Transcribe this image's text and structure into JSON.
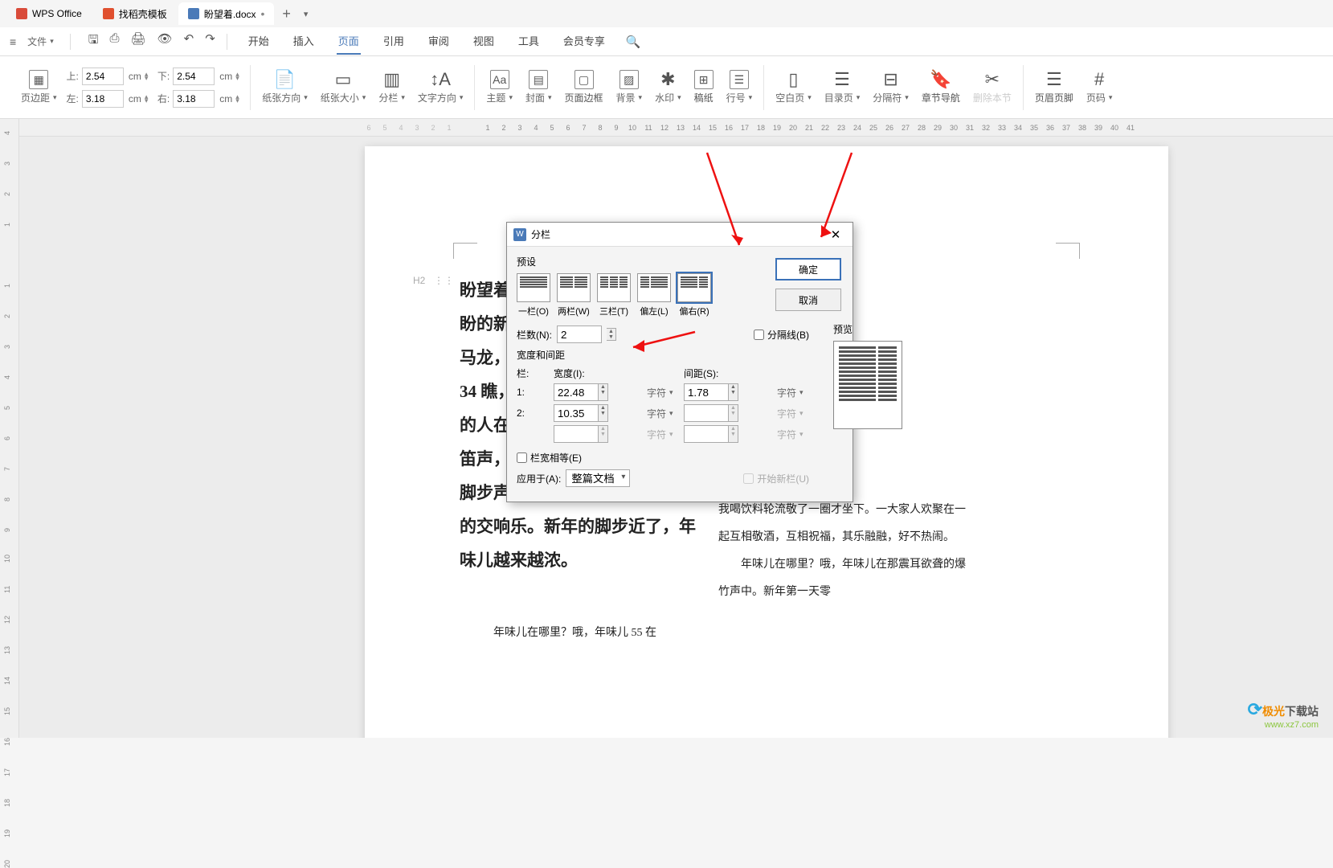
{
  "titlebar": {
    "tabs": [
      {
        "label": "WPS Office",
        "icon_color": "#d94b3a"
      },
      {
        "label": "找稻壳模板",
        "icon_color": "#d94b3a"
      },
      {
        "label": "盼望着.docx",
        "icon_color": "#4a7ab8",
        "modified": "•",
        "active": true
      }
    ]
  },
  "menubar": {
    "file": "文件",
    "tabs": [
      "开始",
      "插入",
      "页面",
      "引用",
      "审阅",
      "视图",
      "工具",
      "会员专享"
    ],
    "active": "页面"
  },
  "ribbon": {
    "margins": {
      "label": "页边距",
      "top_label": "上:",
      "top": "2.54",
      "top_unit": "cm",
      "bottom_label": "下:",
      "bottom": "2.54",
      "bottom_unit": "cm",
      "left_label": "左:",
      "left": "3.18",
      "left_unit": "cm",
      "right_label": "右:",
      "right": "3.18",
      "right_unit": "cm"
    },
    "orientation": "纸张方向",
    "size": "纸张大小",
    "columns": "分栏",
    "direction": "文字方向",
    "theme": "主题",
    "cover": "封面",
    "border": "页面边框",
    "background": "背景",
    "watermark": "水印",
    "manuscript": "稿纸",
    "linenum": "行号",
    "blank": "空白页",
    "toc": "目录页",
    "separator": "分隔符",
    "navigate": "章节导航",
    "delete_section": "删除本节",
    "header_footer": "页眉页脚",
    "page_number": "页码"
  },
  "ruler": {
    "h_left": [
      "6",
      "5",
      "4",
      "3",
      "2",
      "1"
    ],
    "h_right": [
      "1",
      "2",
      "3",
      "4",
      "5",
      "6",
      "7",
      "8",
      "9",
      "10",
      "11",
      "12",
      "13",
      "14",
      "15",
      "16",
      "17",
      "18",
      "19",
      "20",
      "21",
      "22",
      "23",
      "24",
      "25",
      "26",
      "27",
      "28",
      "29",
      "30",
      "31",
      "32",
      "33",
      "34",
      "35",
      "36",
      "37",
      "38",
      "39",
      "40",
      "41"
    ],
    "v": [
      "4",
      "3",
      "2",
      "1",
      "",
      "1",
      "2",
      "3",
      "4",
      "5",
      "6",
      "7",
      "8",
      "9",
      "10",
      "11",
      "12",
      "13",
      "14",
      "15",
      "16",
      "17",
      "18",
      "19",
      "20"
    ]
  },
  "document": {
    "h2_tag": "H2",
    "left_bold": "盼望着，\n盼的新年\n马龙，人\n34 瞧，打\n的人在徘\n笛声，商\n脚步声……编织成热闹而又吉祥的交响乐。新年的脚步近了，年味儿越来越浓。",
    "left_small": "年味儿在哪里？哦，年味儿 55 在",
    "right": "妈就做了满\n桌上热气腾\n深吸一口气，\n颜色也经过妈\n有食欲。爸\n我家附近的\n饭，“表叔，\n成！”“姑\n康快乐！”\n我喝饮料轮流敬了一圈才坐下。一大家人欢聚在一起互相敬酒，互相祝福，其乐融融，好不热闹。\n　　年味儿在哪里？哦，年味儿在那震耳欲聋的爆竹声中。新年第一天零"
  },
  "dialog": {
    "title": "分栏",
    "preset_label": "预设",
    "presets": [
      "一栏(O)",
      "两栏(W)",
      "三栏(T)",
      "偏左(L)",
      "偏右(R)"
    ],
    "selected_preset": 4,
    "ok": "确定",
    "cancel": "取消",
    "cols_label": "栏数(N):",
    "cols_value": "2",
    "sep_line": "分隔线(B)",
    "width_spacing": "宽度和间距",
    "preview_label": "预览",
    "col_hdr": "栏:",
    "width_hdr": "宽度(I):",
    "spacing_hdr": "间距(S):",
    "rows": [
      {
        "n": "1:",
        "w": "22.48",
        "s": "1.78"
      },
      {
        "n": "2:",
        "w": "10.35",
        "s": ""
      }
    ],
    "char_unit": "字符",
    "equal": "栏宽相等(E)",
    "apply_to_label": "应用于(A):",
    "apply_to_value": "整篇文档",
    "start_new": "开始新栏(U)"
  },
  "watermark": {
    "line1_a": "极光",
    "line1_b": "下载站",
    "line2": "www.xz7.com"
  }
}
